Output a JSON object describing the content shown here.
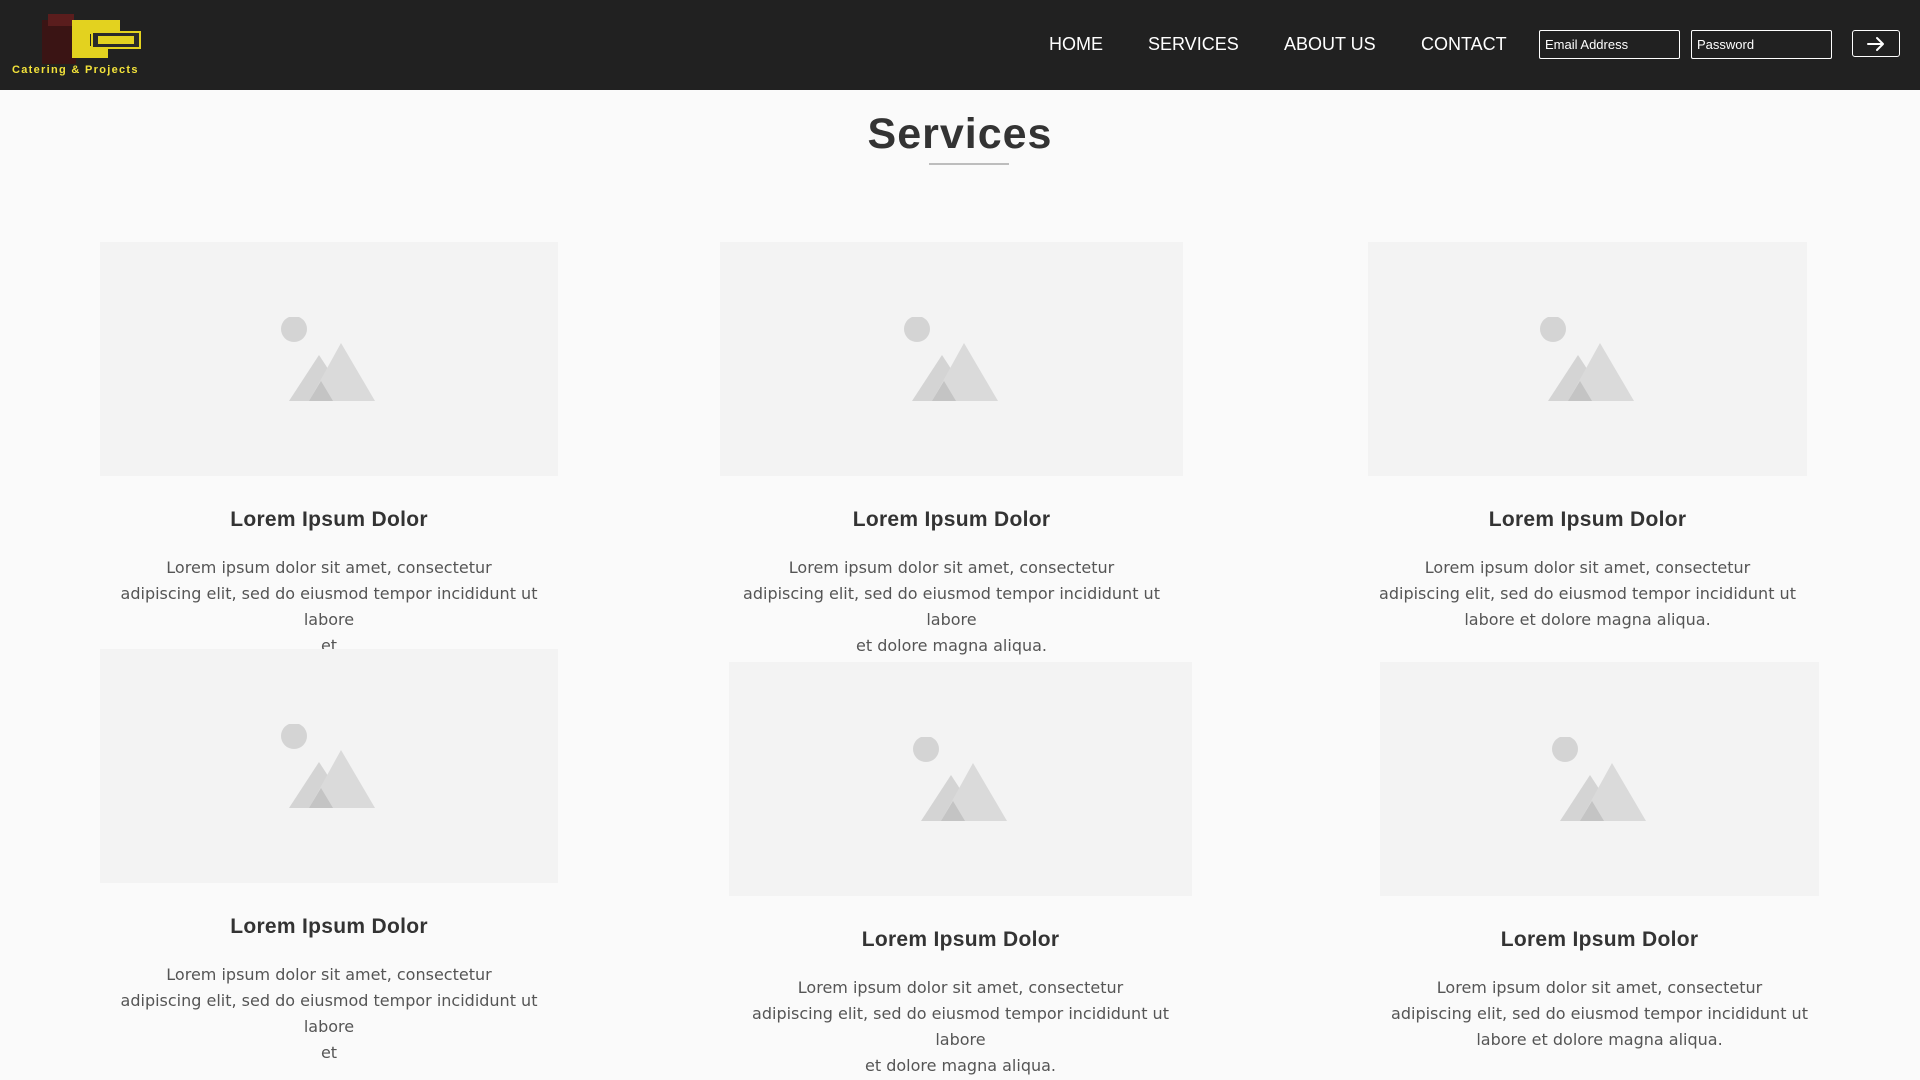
{
  "nav": {
    "logo_text": "Catering & Projects",
    "menu": [
      {
        "label": "HOME"
      },
      {
        "label": "SERVICES"
      },
      {
        "label": "ABOUT US"
      },
      {
        "label": "CONTACT"
      }
    ],
    "email_placeholder": "Email Address",
    "password_placeholder": "Password",
    "login_icon": "arrow-right-icon"
  },
  "page": {
    "title": "Services"
  },
  "cards": [
    {
      "title": "Lorem Ipsum Dolor",
      "lines": [
        "Lorem ipsum dolor sit amet, consectetur",
        "adipiscing elit, sed do eiusmod tempor incididunt ut labore",
        "et"
      ]
    },
    {
      "title": "Lorem Ipsum Dolor",
      "lines": [
        "Lorem ipsum dolor sit amet, consectetur",
        "adipiscing elit, sed do eiusmod tempor incididunt ut labore",
        "et dolore magna aliqua."
      ]
    },
    {
      "title": "Lorem Ipsum Dolor",
      "lines": [
        "Lorem ipsum dolor sit amet, consectetur",
        "adipiscing elit, sed do eiusmod tempor incididunt ut",
        "labore et dolore magna aliqua."
      ]
    },
    {
      "title": "Lorem Ipsum Dolor",
      "lines": [
        "Lorem ipsum dolor sit amet, consectetur",
        "adipiscing elit, sed do eiusmod tempor incididunt ut labore",
        "et"
      ]
    },
    {
      "title": "Lorem Ipsum Dolor",
      "lines": [
        "Lorem ipsum dolor sit amet, consectetur",
        "adipiscing elit, sed do eiusmod tempor incididunt ut labore",
        "et dolore magna aliqua."
      ]
    },
    {
      "title": "Lorem Ipsum Dolor",
      "lines": [
        "Lorem ipsum dolor sit amet, consectetur",
        "adipiscing elit, sed do eiusmod tempor incididunt ut",
        "labore et dolore magna aliqua."
      ]
    }
  ],
  "colors": {
    "nav_bg": "#212121",
    "page_bg": "#fafafa",
    "heading": "#333333",
    "body_text": "#555555",
    "placeholder_bg": "#f3f3f3",
    "logo_accent": "#f2e23a"
  }
}
